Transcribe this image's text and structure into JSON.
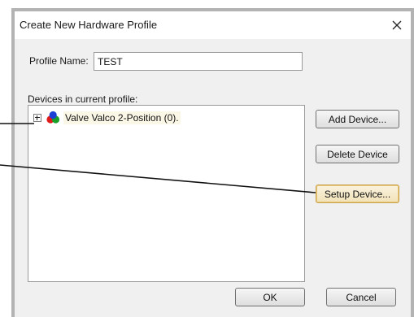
{
  "window": {
    "title": "Create New Hardware Profile",
    "close_icon": "close-icon"
  },
  "profile": {
    "label": "Profile Name:",
    "value": "TEST"
  },
  "devices": {
    "label": "Devices in current profile:",
    "items": [
      {
        "label": "Valve Valco 2-Position (0).",
        "icon": "device-rgb-dots-icon",
        "expanded": false
      }
    ]
  },
  "buttons": {
    "add": "Add Device...",
    "delete": "Delete Device",
    "setup": "Setup Device...",
    "ok": "OK",
    "cancel": "Cancel"
  },
  "colors": {
    "dialog_bg": "#f0f0f0",
    "focus_border": "#c9a24a",
    "icon_red": "#e01b1b",
    "icon_green": "#1aa02a",
    "icon_blue": "#1c3fd6"
  }
}
